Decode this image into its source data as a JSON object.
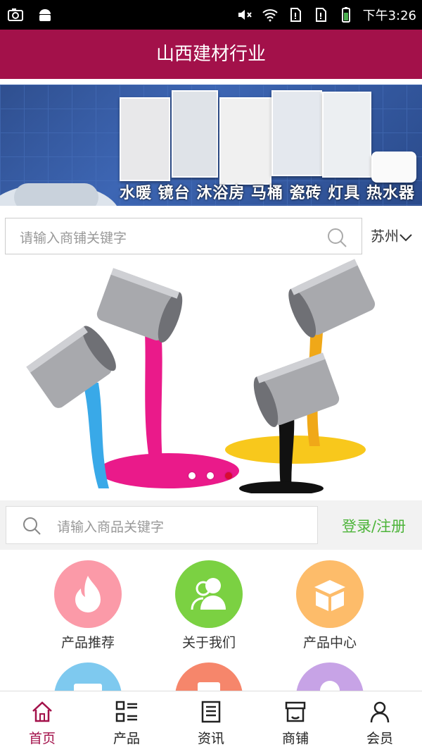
{
  "status_bar": {
    "time": "下午3:26"
  },
  "header": {
    "title": "山西建材行业"
  },
  "banner": {
    "caption": "水暖 镜台 沐浴房 马桶 瓷砖 灯具 热水器"
  },
  "shop_search": {
    "placeholder": "请输入商铺关键字",
    "city": "苏州"
  },
  "carousel": {
    "active_index": 2,
    "count": 3
  },
  "product_search": {
    "placeholder": "请输入商品关键字",
    "login_label": "登录/注册"
  },
  "categories": [
    {
      "label": "产品推荐",
      "icon": "fire-icon",
      "color": "#fb9aa8"
    },
    {
      "label": "关于我们",
      "icon": "users-icon",
      "color": "#7bd142"
    },
    {
      "label": "产品中心",
      "icon": "box-icon",
      "color": "#fdbc6a"
    },
    {
      "label": "",
      "icon": "message-icon",
      "color": "#7ec9ef"
    },
    {
      "label": "",
      "icon": "document-icon",
      "color": "#f6866b"
    },
    {
      "label": "",
      "icon": "chat-icon",
      "color": "#c7a3e6"
    }
  ],
  "tabbar": {
    "items": [
      {
        "label": "首页",
        "icon": "home-icon",
        "active": true
      },
      {
        "label": "产品",
        "icon": "grid-list-icon",
        "active": false
      },
      {
        "label": "资讯",
        "icon": "news-icon",
        "active": false
      },
      {
        "label": "商铺",
        "icon": "shop-icon",
        "active": false
      },
      {
        "label": "会员",
        "icon": "user-icon",
        "active": false
      }
    ],
    "active_color": "#a3114a"
  }
}
